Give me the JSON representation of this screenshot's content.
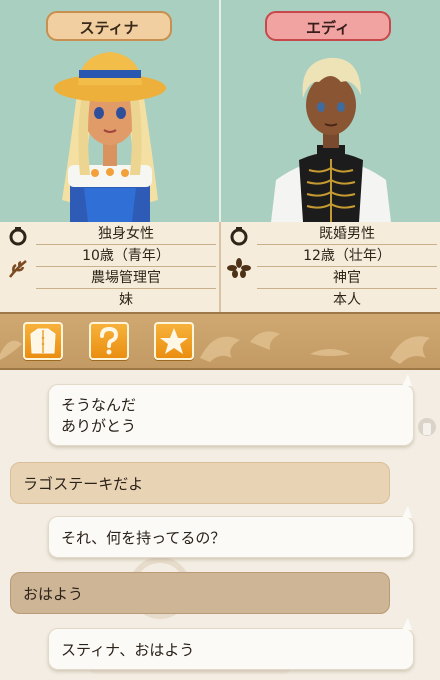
{
  "characters": [
    {
      "name": "スティナ",
      "info": [
        "独身女性",
        "10歳（青年）",
        "農場管理官",
        "妹"
      ]
    },
    {
      "name": "エディ",
      "info": [
        "既婚男性",
        "12歳（壮年）",
        "神官",
        "本人"
      ]
    }
  ],
  "toolbar": {
    "buttons": [
      {
        "name": "profile-button",
        "icon": "coat-icon"
      },
      {
        "name": "help-button",
        "icon": "question-icon"
      },
      {
        "name": "favorite-button",
        "icon": "star-icon"
      }
    ]
  },
  "chat": {
    "messages": [
      {
        "text_line1": "そうなんだ",
        "text_line2": "ありがとう",
        "style": "white"
      },
      {
        "text": "ラゴステーキだよ",
        "style": "tan"
      },
      {
        "text": "それ、何を持ってるの？",
        "style": "white"
      },
      {
        "text": "おはよう",
        "style": "dark"
      },
      {
        "text": "スティナ、おはよう",
        "style": "white"
      }
    ]
  },
  "colors": {
    "portrait_bg": "#a9cfc0",
    "name_left_bg": "#f2cfa0",
    "name_right_bg": "#f0a3a0",
    "toolbar_bg": "#c39a63",
    "button_orange": "#ea8e11"
  }
}
